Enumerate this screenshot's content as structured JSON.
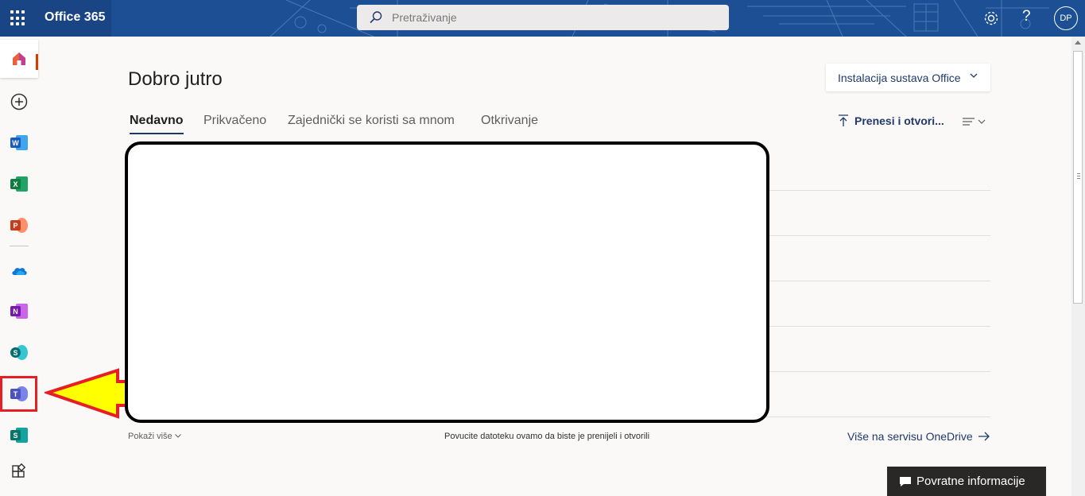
{
  "header": {
    "app_name": "Office 365",
    "search_placeholder": "Pretraživanje",
    "help_label": "?",
    "user_initials": "DP"
  },
  "rail": {
    "word_letter": "W",
    "excel_letter": "X",
    "powerpoint_letter": "P",
    "onenote_letter": "N",
    "sharepoint_letter": "S",
    "teams_letter": "T",
    "sway_letter": "S"
  },
  "main": {
    "greeting": "Dobro jutro",
    "install_button": "Instalacija sustava Office",
    "tabs": [
      {
        "label": "Nedavno",
        "active": true
      },
      {
        "label": "Prikvačeno",
        "active": false
      },
      {
        "label": "Zajednički se koristi sa mnom",
        "active": false
      },
      {
        "label": "Otkrivanje",
        "active": false
      }
    ],
    "upload_label": "Prenesi i otvori...",
    "show_more": "Pokaži više",
    "drop_hint": "Povucite datoteku ovamo da biste je prenijeli i otvorili",
    "onedrive_link": "Više na servisu OneDrive"
  },
  "feedback": {
    "label": "Povratne informacije"
  },
  "colors": {
    "header_bg": "#1c4f94",
    "accent": "#1f3a6a",
    "annotation_red": "#e81e25",
    "annotation_yellow": "#ffff00"
  }
}
